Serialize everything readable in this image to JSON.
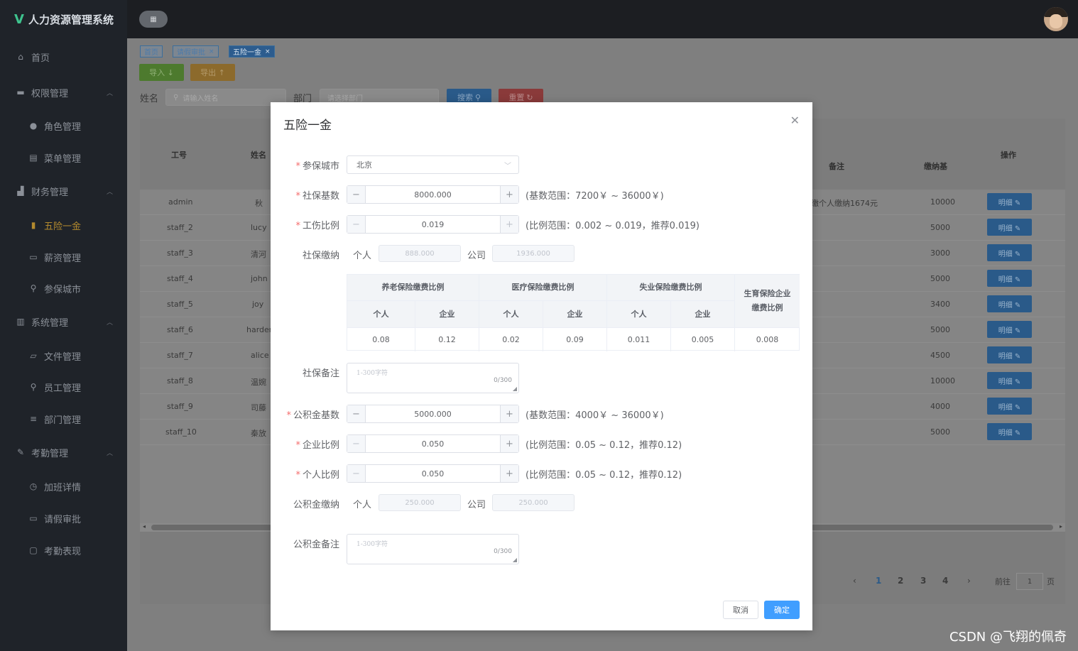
{
  "app": {
    "title": "人力资源管理系统"
  },
  "sidebar": {
    "items": [
      {
        "label": "首页",
        "icon": "home-icon",
        "level": 1
      },
      {
        "label": "权限管理",
        "icon": "briefcase-icon",
        "level": 1,
        "expanded": true
      },
      {
        "label": "角色管理",
        "icon": "user-icon",
        "level": 2
      },
      {
        "label": "菜单管理",
        "icon": "document-icon",
        "level": 2
      },
      {
        "label": "财务管理",
        "icon": "chart-icon",
        "level": 1,
        "expanded": true
      },
      {
        "label": "五险一金",
        "icon": "bar-chart-icon",
        "level": 2,
        "active": true
      },
      {
        "label": "薪资管理",
        "icon": "money-icon",
        "level": 2
      },
      {
        "label": "参保城市",
        "icon": "person-icon",
        "level": 2
      },
      {
        "label": "系统管理",
        "icon": "stats-icon",
        "level": 1,
        "expanded": true
      },
      {
        "label": "文件管理",
        "icon": "folder-icon",
        "level": 2
      },
      {
        "label": "员工管理",
        "icon": "person-icon",
        "level": 2
      },
      {
        "label": "部门管理",
        "icon": "list-icon",
        "level": 2
      },
      {
        "label": "考勤管理",
        "icon": "pen-icon",
        "level": 1,
        "expanded": true
      },
      {
        "label": "加班详情",
        "icon": "clock-icon",
        "level": 2
      },
      {
        "label": "请假审批",
        "icon": "suitcase-icon",
        "level": 2
      },
      {
        "label": "考勤表现",
        "icon": "calendar-icon",
        "level": 2
      }
    ]
  },
  "tabs": [
    {
      "label": "首页",
      "closable": false
    },
    {
      "label": "请假审批",
      "closable": true
    },
    {
      "label": "五险一金",
      "closable": true,
      "active": true
    }
  ],
  "toolbar": {
    "import_label": "导入 ↓",
    "export_label": "导出 ↑",
    "name_label": "姓名",
    "name_placeholder": "请输入姓名",
    "dept_label": "部门",
    "dept_placeholder": "请选择部门",
    "search_label": "搜索",
    "reset_label": "重置"
  },
  "table": {
    "headers": {
      "id": "工号",
      "name": "姓名",
      "remark": "备注",
      "base": "缴纳基",
      "action": "操作"
    },
    "rows": [
      {
        "id": "admin",
        "name": "秋",
        "remark": "缴个人缴纳1674元",
        "base": "10000"
      },
      {
        "id": "staff_2",
        "name": "lucy",
        "remark": "",
        "base": "5000"
      },
      {
        "id": "staff_3",
        "name": "清河",
        "remark": "",
        "base": "3000"
      },
      {
        "id": "staff_4",
        "name": "john",
        "remark": "",
        "base": "5000"
      },
      {
        "id": "staff_5",
        "name": "joy",
        "remark": "",
        "base": "3400"
      },
      {
        "id": "staff_6",
        "name": "harden",
        "remark": "",
        "base": "5000"
      },
      {
        "id": "staff_7",
        "name": "alice",
        "remark": "",
        "base": "4500"
      },
      {
        "id": "staff_8",
        "name": "温婉",
        "remark": "",
        "base": "10000"
      },
      {
        "id": "staff_9",
        "name": "司藤",
        "remark": "",
        "base": "4000"
      },
      {
        "id": "staff_10",
        "name": "秦放",
        "remark": "",
        "base": "5000"
      }
    ],
    "detail_label": "明细 ✎"
  },
  "pagination": {
    "pages": [
      "1",
      "2",
      "3",
      "4"
    ],
    "current": "1",
    "goto_prefix": "前往",
    "goto_value": "1",
    "goto_suffix": "页"
  },
  "dialog": {
    "title": "五险一金",
    "city": {
      "label": "参保城市",
      "value": "北京"
    },
    "social_base": {
      "label": "社保基数",
      "value": "8000.000",
      "hint": "(基数范围：7200￥ ~ 36000￥)"
    },
    "injury_ratio": {
      "label": "工伤比例",
      "value": "0.019",
      "hint": "(比例范围：0.002 ~ 0.019，推荐0.019)"
    },
    "social_pay": {
      "label": "社保缴纳",
      "personal_label": "个人",
      "personal_value": "888.000",
      "company_label": "公司",
      "company_value": "1936.000"
    },
    "ratio_table": {
      "groups": [
        "养老保险缴费比例",
        "医疗保险缴费比例",
        "失业保险缴费比例"
      ],
      "maternity": "生育保险企业缴费比例",
      "personal": "个人",
      "company": "企业",
      "values": [
        "0.08",
        "0.12",
        "0.02",
        "0.09",
        "0.011",
        "0.005",
        "0.008"
      ]
    },
    "social_note": {
      "label": "社保备注",
      "placeholder": "1-300字符",
      "count": "0/300"
    },
    "fund_base": {
      "label": "公积金基数",
      "value": "5000.000",
      "hint": "(基数范围：4000￥ ~ 36000￥)"
    },
    "company_ratio": {
      "label": "企业比例",
      "value": "0.050",
      "hint": "(比例范围：0.05 ~ 0.12，推荐0.12)"
    },
    "personal_ratio": {
      "label": "个人比例",
      "value": "0.050",
      "hint": "(比例范围：0.05 ~ 0.12，推荐0.12)"
    },
    "fund_pay": {
      "label": "公积金缴纳",
      "personal_label": "个人",
      "personal_value": "250.000",
      "company_label": "公司",
      "company_value": "250.000"
    },
    "fund_note": {
      "label": "公积金备注",
      "placeholder": "1-300字符",
      "count": "0/300"
    },
    "cancel_label": "取消",
    "confirm_label": "确定"
  },
  "watermark": "CSDN @飞翔的佩奇",
  "colors": {
    "primary": "#409eff",
    "required": "#f56c6c",
    "sidebar_bg": "#1f2329",
    "active_menu": "#b38a2e"
  }
}
